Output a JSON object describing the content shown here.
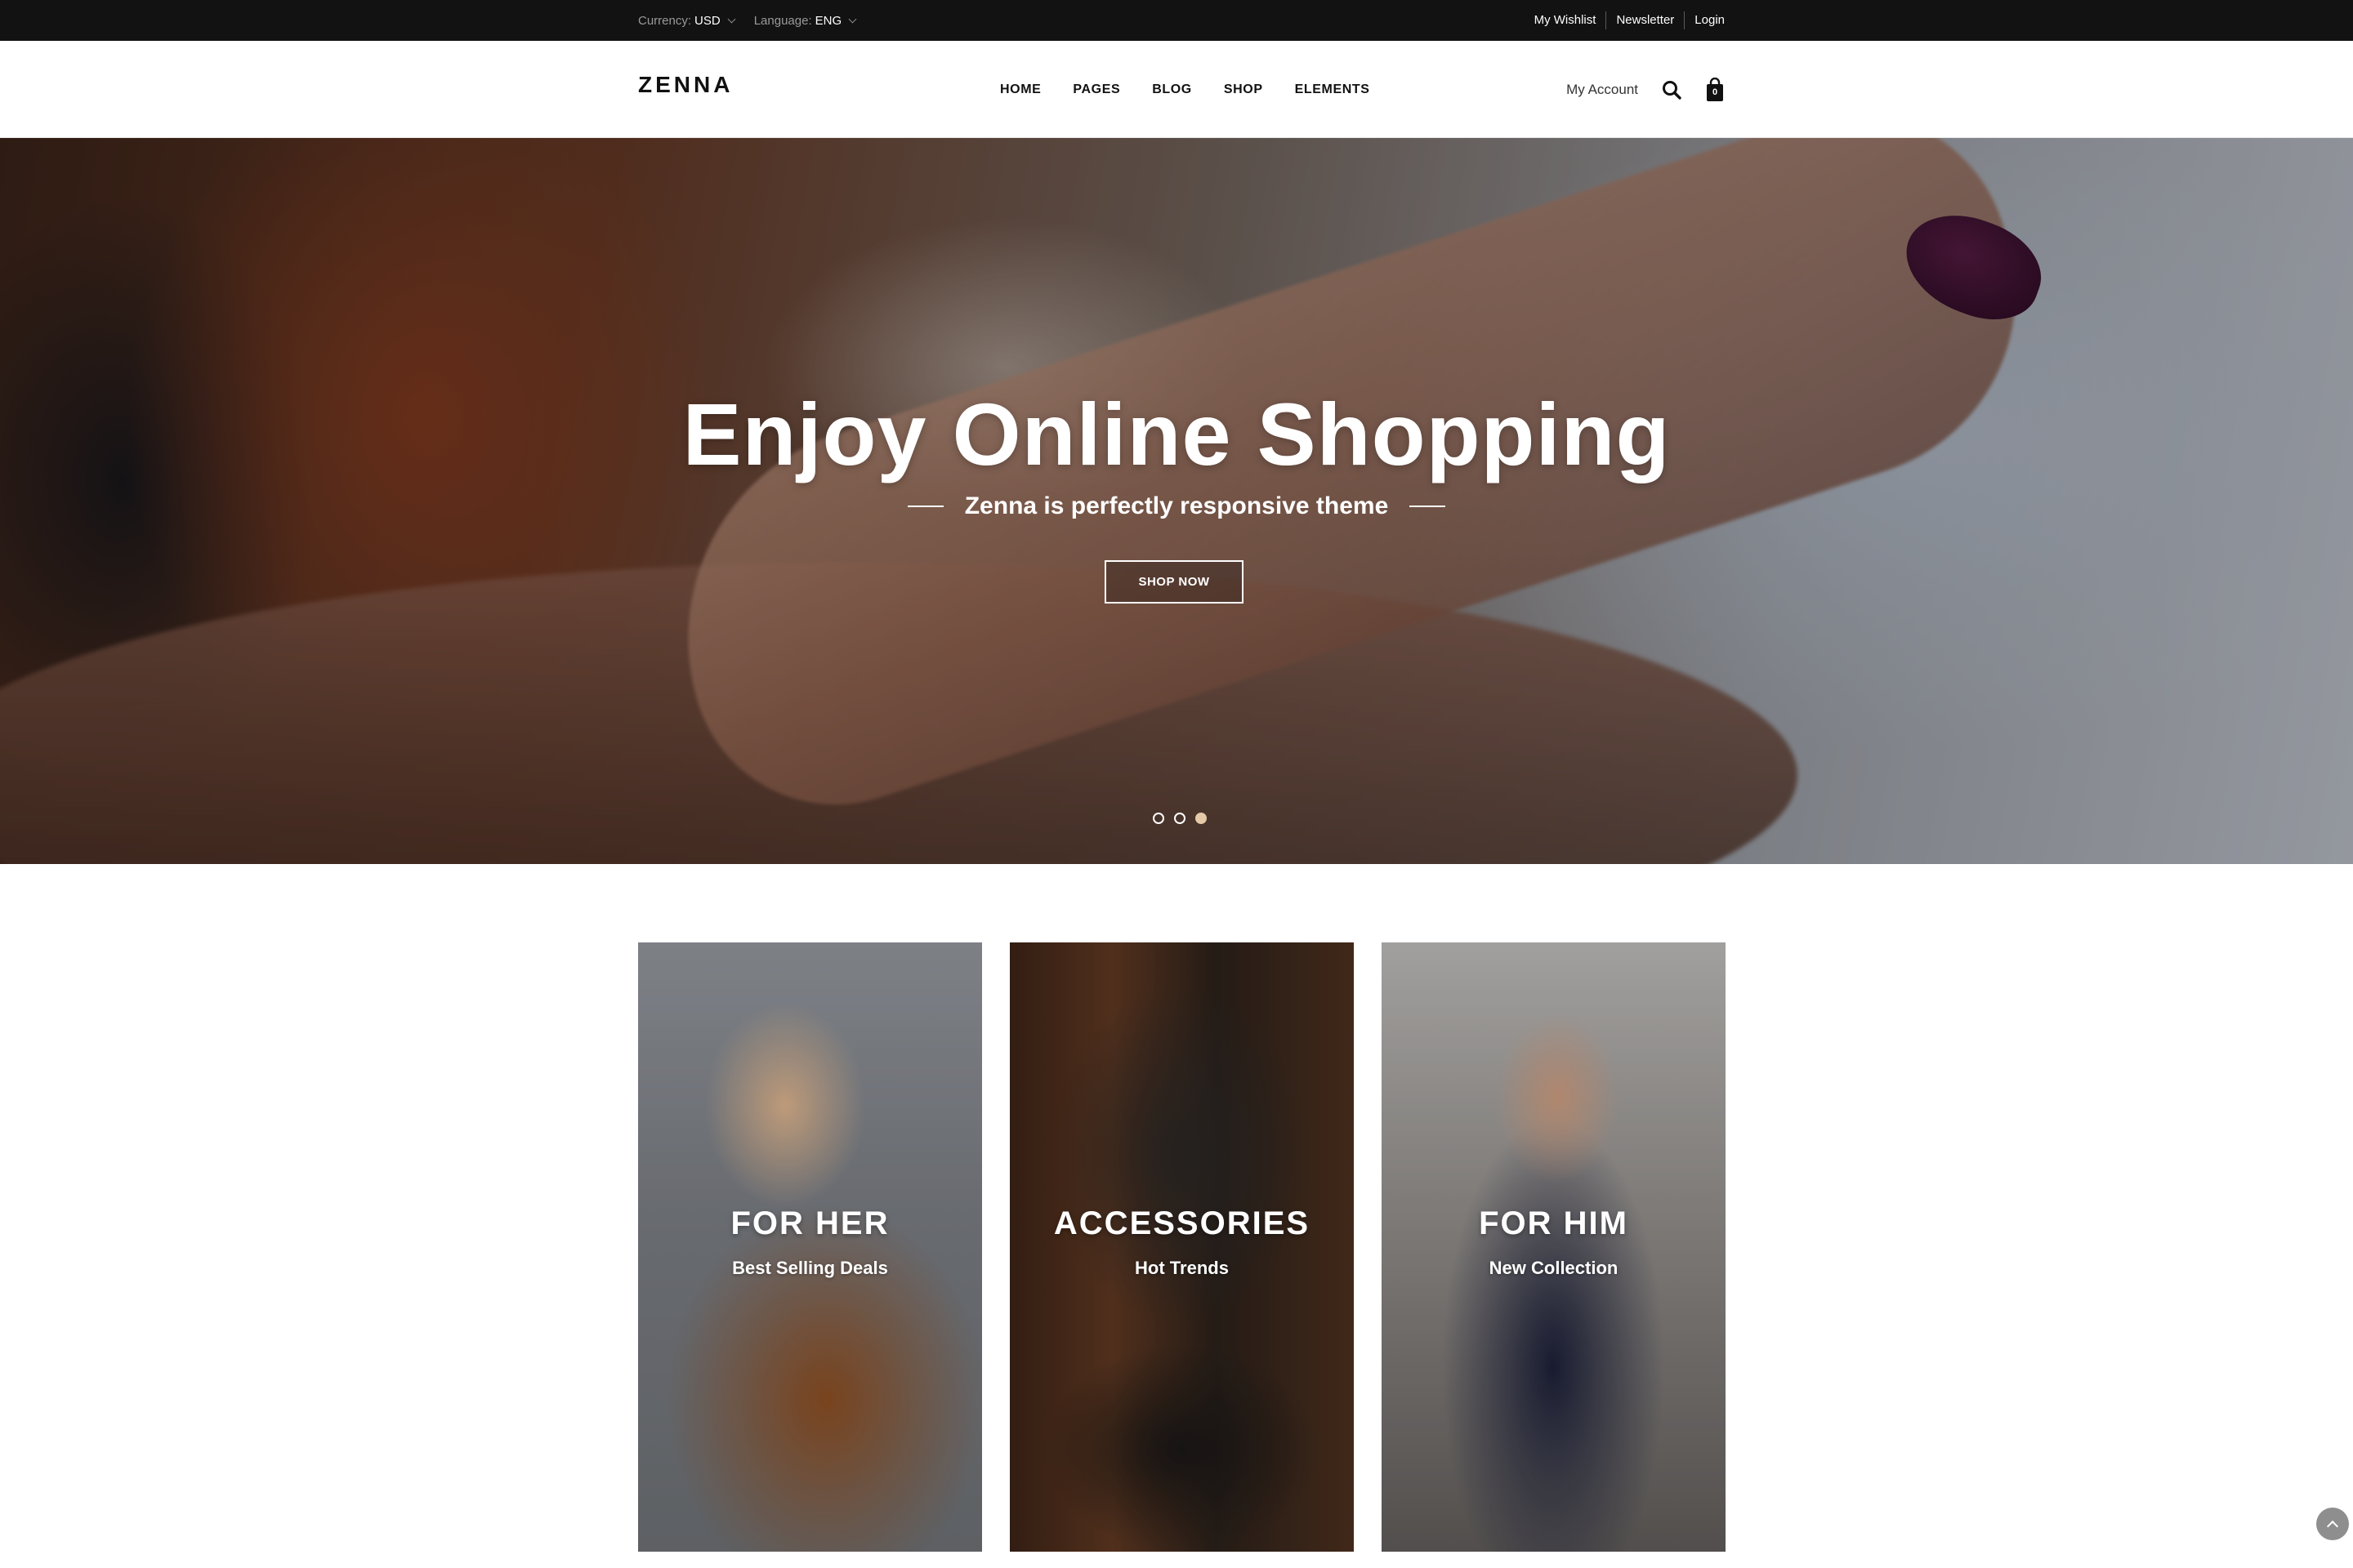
{
  "topbar": {
    "currency_label": "Currency:",
    "currency_value": "USD",
    "language_label": "Language:",
    "language_value": "ENG",
    "links": [
      "My Wishlist",
      "Newsletter",
      "Login"
    ]
  },
  "header": {
    "logo": "ZENNA",
    "nav": [
      "HOME",
      "PAGES",
      "BLOG",
      "SHOP",
      "ELEMENTS"
    ],
    "account": "My Account",
    "cart_count": "0",
    "icons": [
      "search-icon",
      "shopping-bag-icon"
    ]
  },
  "hero": {
    "title": "Enjoy Online Shopping",
    "subtitle": "Zenna is perfectly responsive theme",
    "button": "SHOP NOW",
    "slides": 3,
    "active_slide": 3
  },
  "categories": [
    {
      "title": "FOR HER",
      "subtitle": "Best Selling Deals"
    },
    {
      "title": "ACCESSORIES",
      "subtitle": "Hot Trends"
    },
    {
      "title": "FOR HIM",
      "subtitle": "New Collection"
    }
  ],
  "colors": {
    "topbar_bg": "#121212",
    "accent_dot": "#e6c9a8",
    "text_dark": "#111111"
  }
}
